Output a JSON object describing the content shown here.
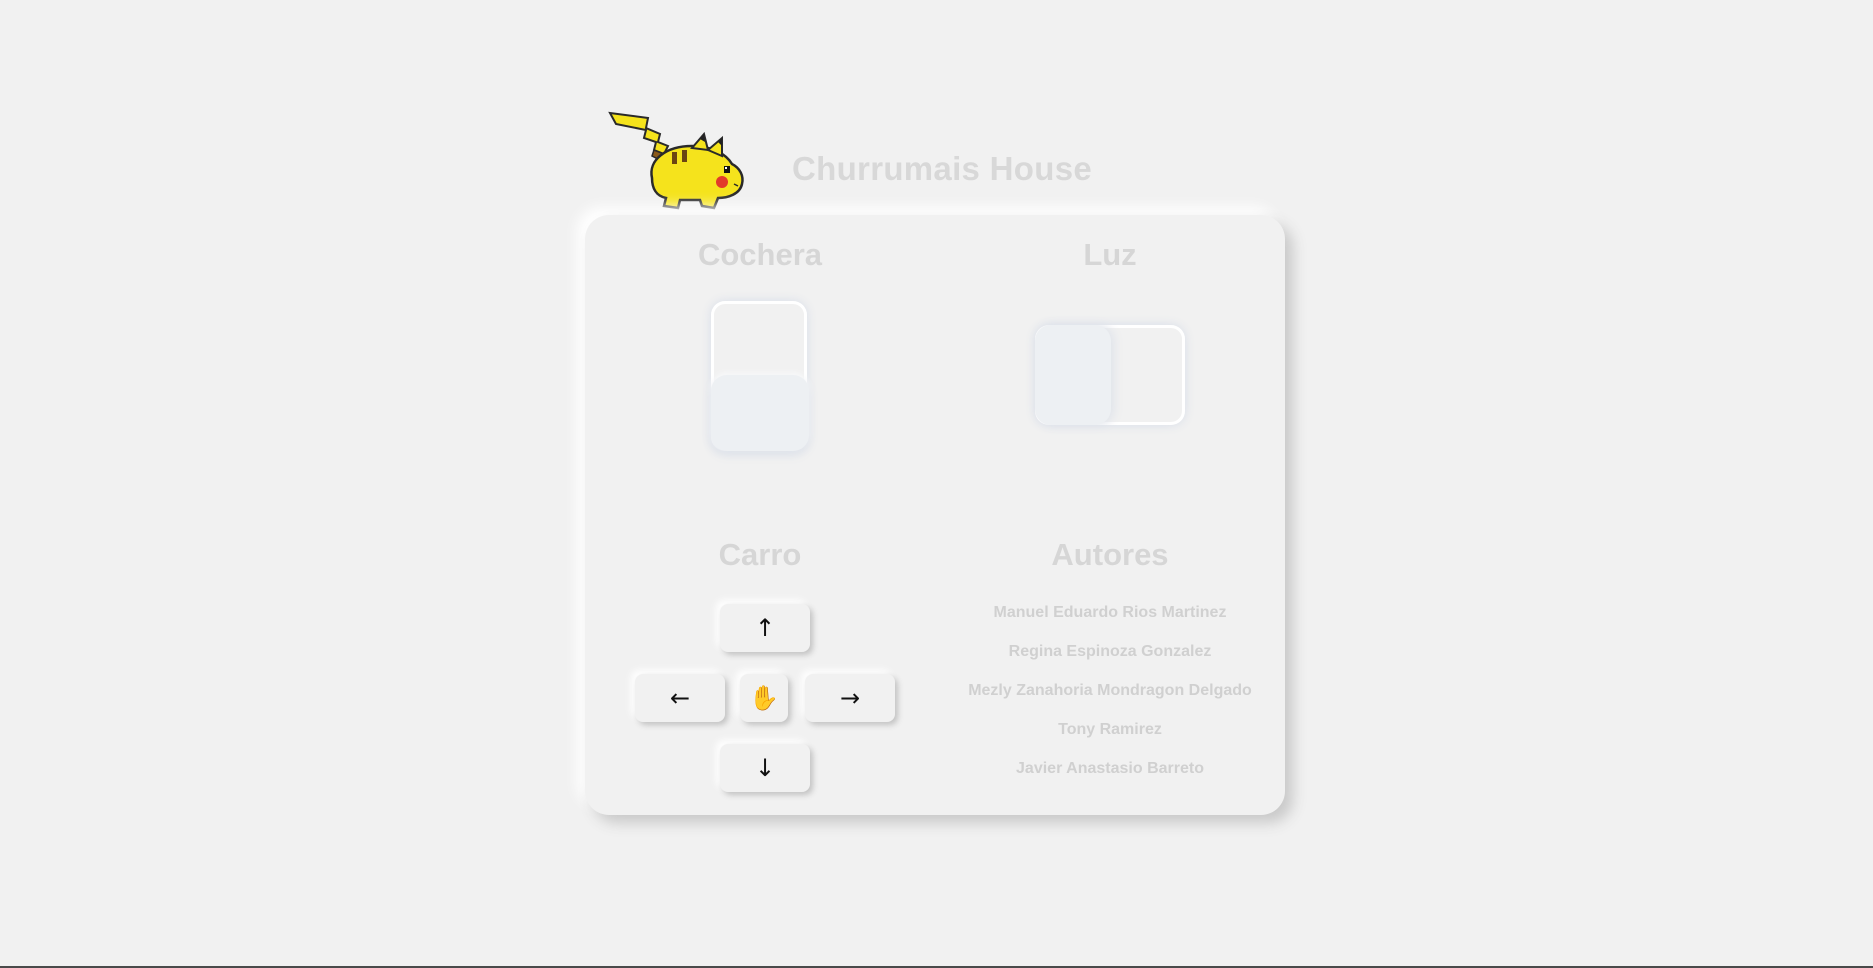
{
  "header": {
    "title": "Churrumais House",
    "mascot_icon": "pikachu-icon"
  },
  "sections": {
    "cochera": {
      "title": "Cochera",
      "switch_state": "off"
    },
    "luz": {
      "title": "Luz",
      "switch_state": "off"
    },
    "carro": {
      "title": "Carro",
      "controls": {
        "up": "↑",
        "left": "←",
        "stop": "✋",
        "right": "→",
        "down": "↓"
      }
    },
    "autores": {
      "title": "Autores",
      "names": [
        "Manuel Eduardo Rios Martinez",
        "Regina Espinoza Gonzalez",
        "Mezly Zanahoria Mondragon Delgado",
        "Tony Ramirez",
        "Javier Anastasio Barreto"
      ]
    }
  },
  "colors": {
    "background": "#f1f1f1",
    "title_text": "#d8d8d8",
    "mascot_yellow": "#f5e31c",
    "mascot_cheek": "#e23a2a"
  }
}
